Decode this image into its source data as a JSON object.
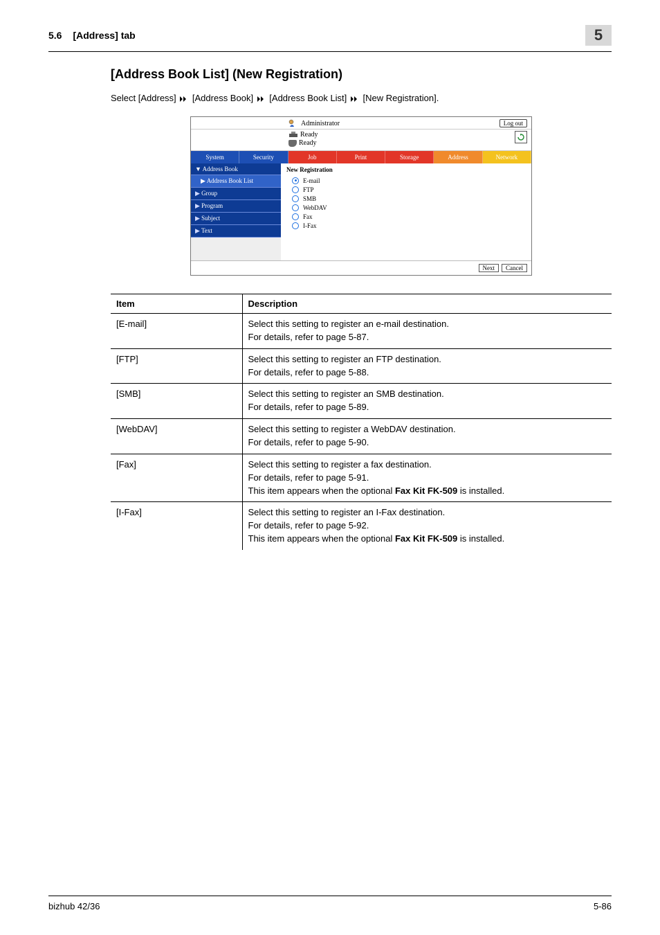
{
  "header": {
    "section_number": "5.6",
    "section_label": "[Address] tab",
    "chapter_number": "5"
  },
  "title": "[Address Book List] (New Registration)",
  "breadcrumb": {
    "prefix": "Select",
    "parts": [
      "[Address]",
      "[Address Book]",
      "[Address Book List]",
      "[New Registration]."
    ]
  },
  "screenshot": {
    "admin_label": "Administrator",
    "logout_label": "Log out",
    "status_lines": [
      "Ready",
      "Ready"
    ],
    "tabs": [
      "System",
      "Security",
      "Job",
      "Print",
      "Storage",
      "Address",
      "Network"
    ],
    "sidebar": {
      "main": "Address Book",
      "sub": "Address Book List",
      "items": [
        "Group",
        "Program",
        "Subject",
        "Text"
      ]
    },
    "content_header": "New Registration",
    "radio_options": [
      "E-mail",
      "FTP",
      "SMB",
      "WebDAV",
      "Fax",
      "I-Fax"
    ],
    "selected_index": 0,
    "next_label": "Next",
    "cancel_label": "Cancel"
  },
  "table": {
    "head_item": "Item",
    "head_desc": "Description",
    "rows": [
      {
        "item": "[E-mail]",
        "lines": [
          "Select this setting to register an e-mail destination.",
          "For details, refer to page 5-87."
        ]
      },
      {
        "item": "[FTP]",
        "lines": [
          "Select this setting to register an FTP destination.",
          "For details, refer to page 5-88."
        ]
      },
      {
        "item": "[SMB]",
        "lines": [
          "Select this setting to register an SMB destination.",
          "For details, refer to page 5-89."
        ]
      },
      {
        "item": "[WebDAV]",
        "lines": [
          "Select this setting to register a WebDAV destination.",
          "For details, refer to page 5-90."
        ]
      },
      {
        "item": "[Fax]",
        "lines": [
          "Select this setting to register a fax destination.",
          "For details, refer to page 5-91.",
          "This item appears when the optional <b>Fax Kit FK-509</b> is installed."
        ]
      },
      {
        "item": "[I-Fax]",
        "lines": [
          "Select this setting to register an I-Fax destination.",
          "For details, refer to page 5-92.",
          "This item appears when the optional <b>Fax Kit FK-509</b> is installed."
        ]
      }
    ]
  },
  "footer": {
    "left": "bizhub 42/36",
    "right": "5-86"
  }
}
